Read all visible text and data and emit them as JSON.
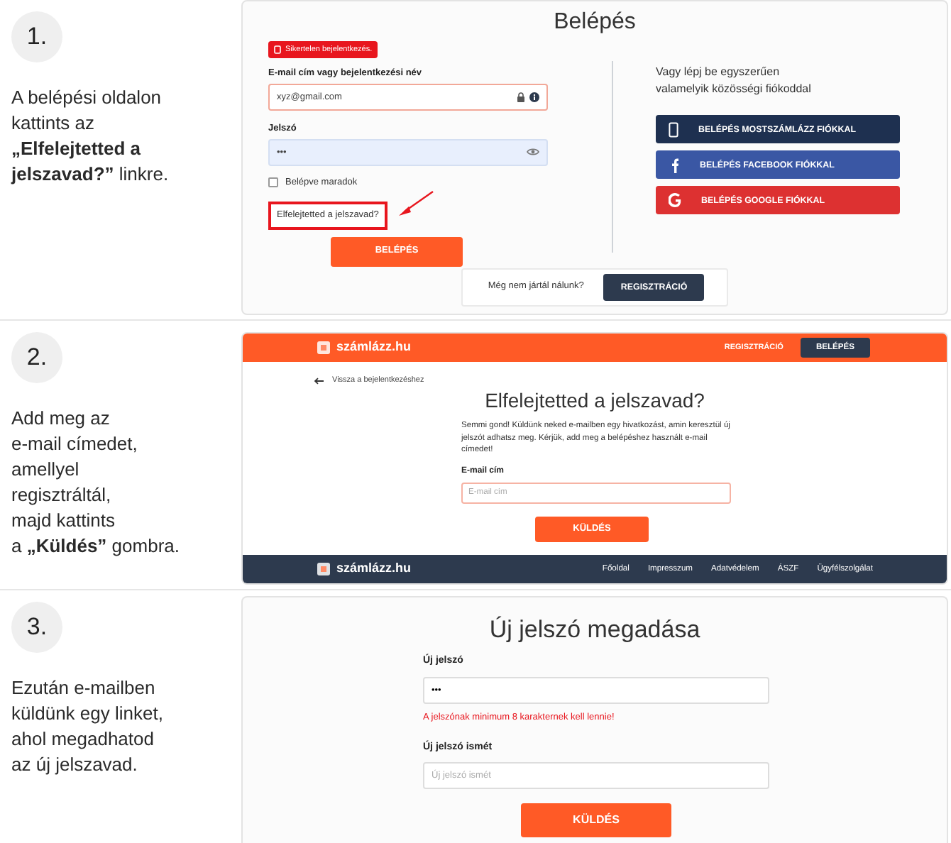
{
  "steps": [
    {
      "number": "1.",
      "text_lines": [
        "A belépési oldalon",
        "kattints az",
        "**„Elfelejtetted a**",
        "**jelszavad?”** linkre."
      ]
    },
    {
      "number": "2.",
      "text_lines": [
        "Add meg az",
        "e-mail címedet,",
        "amellyel",
        "regisztráltál,",
        "majd kattints",
        "a **„Küldés”** gombra."
      ]
    },
    {
      "number": "3.",
      "text_lines": [
        "Ezután e-mailben",
        "küldünk egy linket,",
        "ahol megadhatod",
        "az új jelszavad."
      ]
    }
  ],
  "login_screen": {
    "title": "Belépés",
    "error": "Sikertelen bejelentkezés.",
    "email_label": "E-mail cím vagy bejelentkezési név",
    "email_value": "xyz@gmail.com",
    "password_label": "Jelszó",
    "password_value": "•••",
    "remember_label": "Belépve maradok",
    "remember_checked": false,
    "forgot_link": "Elfelejtetted a jelszavad?",
    "login_button": "BELÉPÉS",
    "social_intro_lines": [
      "Vagy lépj be egyszerűen",
      "valamelyik közösségi fiókoddal"
    ],
    "social_buttons": [
      {
        "kind": "phone",
        "label": "BELÉPÉS MOSTSZÁMLÁZZ FIÓKKAL"
      },
      {
        "kind": "facebook",
        "label": "BELÉPÉS FACEBOOK FIÓKKAL"
      },
      {
        "kind": "google",
        "label": "BELÉPÉS GOOGLE FIÓKKAL"
      }
    ],
    "register_prompt": "Még nem jártál nálunk?",
    "register_button": "REGISZTRÁCIÓ"
  },
  "forgot_screen": {
    "header": {
      "logo": "számlázz.hu",
      "register_link": "REGISZTRÁCIÓ",
      "login_button": "BELÉPÉS"
    },
    "back_link": "Vissza a bejelentkezéshez",
    "title": "Elfelejtetted a jelszavad?",
    "description": "Semmi gond! Küldünk neked e-mailben egy hivatkozást, amin keresztül új jelszót adhatsz meg. Kérjük, add meg a belépéshez használt e-mail címedet!",
    "email_label": "E-mail cím",
    "email_placeholder": "E-mail cím",
    "submit_button": "KÜLDÉS",
    "footer": {
      "logo": "számlázz.hu",
      "links": [
        "Főoldal",
        "Impresszum",
        "Adatvédelem",
        "ÁSZF",
        "Ügyfélszolgálat"
      ]
    }
  },
  "new_password_screen": {
    "title": "Új jelszó megadása",
    "password_label": "Új jelszó",
    "password_value": "•••",
    "error": "A jelszónak minimum 8 karakternek kell lennie!",
    "repeat_label": "Új jelszó ismét",
    "repeat_placeholder": "Új jelszó ismét",
    "submit_button": "KÜLDÉS"
  }
}
